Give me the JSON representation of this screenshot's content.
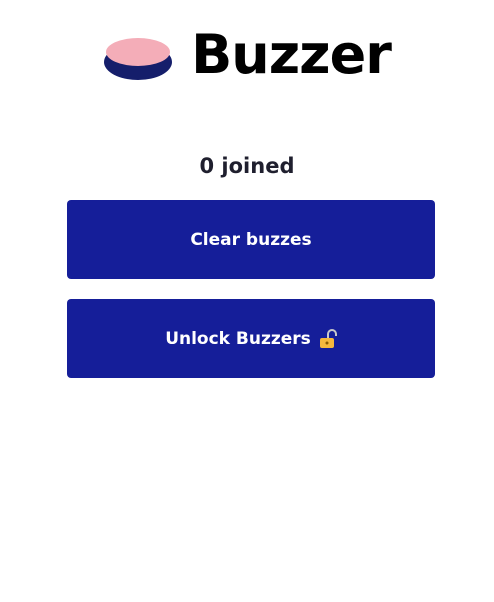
{
  "app": {
    "logo_text": "Buzzer",
    "logo_icon": "buzzer-button-icon"
  },
  "status": {
    "joined_text": "0 joined"
  },
  "actions": {
    "clear_label": "Clear buzzes",
    "unlock_label": "Unlock Buzzers",
    "unlock_icon": "unlocked-padlock-icon"
  },
  "colors": {
    "button_bg": "#151e99",
    "button_text": "#ffffff",
    "logo_base": "#151e6b",
    "logo_top": "#f4adb8",
    "lock_body": "#f5b83d"
  }
}
